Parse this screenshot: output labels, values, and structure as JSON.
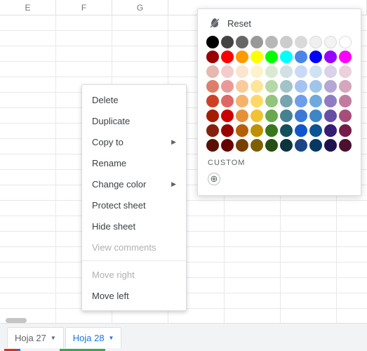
{
  "columns": [
    "E",
    "F",
    "G"
  ],
  "context_menu": {
    "items": [
      {
        "label": "Delete",
        "has_sub": false,
        "disabled": false,
        "key": "delete"
      },
      {
        "label": "Duplicate",
        "has_sub": false,
        "disabled": false,
        "key": "duplicate"
      },
      {
        "label": "Copy to",
        "has_sub": true,
        "disabled": false,
        "key": "copy-to"
      },
      {
        "label": "Rename",
        "has_sub": false,
        "disabled": false,
        "key": "rename"
      },
      {
        "label": "Change color",
        "has_sub": true,
        "disabled": false,
        "key": "change-color",
        "highlighted": true
      },
      {
        "label": "Protect sheet",
        "has_sub": false,
        "disabled": false,
        "key": "protect-sheet"
      },
      {
        "label": "Hide sheet",
        "has_sub": false,
        "disabled": false,
        "key": "hide-sheet"
      },
      {
        "label": "View comments",
        "has_sub": false,
        "disabled": true,
        "key": "view-comments"
      },
      {
        "sep": true
      },
      {
        "label": "Move right",
        "has_sub": false,
        "disabled": true,
        "key": "move-right"
      },
      {
        "label": "Move left",
        "has_sub": false,
        "disabled": false,
        "key": "move-left"
      }
    ]
  },
  "color_panel": {
    "reset_label": "Reset",
    "custom_label": "CUSTOM",
    "rows": [
      [
        "#000000",
        "#434343",
        "#666666",
        "#999999",
        "#b7b7b7",
        "#cccccc",
        "#d9d9d9",
        "#efefef",
        "#f3f3f3",
        "#ffffff"
      ],
      [
        "#980000",
        "#ff0000",
        "#ff9900",
        "#ffff00",
        "#00ff00",
        "#00ffff",
        "#4a86e8",
        "#0000ff",
        "#9900ff",
        "#ff00ff"
      ],
      [
        "#e6b8af",
        "#f4cccc",
        "#fce5cd",
        "#fff2cc",
        "#d9ead3",
        "#d0e0e3",
        "#c9daf8",
        "#cfe2f3",
        "#d9d2e9",
        "#ead1dc"
      ],
      [
        "#dd7e6b",
        "#ea9999",
        "#f9cb9c",
        "#ffe599",
        "#b6d7a8",
        "#a2c4c9",
        "#a4c2f4",
        "#9fc5e8",
        "#b4a7d6",
        "#d5a6bd"
      ],
      [
        "#cc4125",
        "#e06666",
        "#f6b26b",
        "#ffd966",
        "#93c47d",
        "#76a5af",
        "#6d9eeb",
        "#6fa8dc",
        "#8e7cc3",
        "#c27ba0"
      ],
      [
        "#a61c00",
        "#cc0000",
        "#e69138",
        "#f1c232",
        "#6aa84f",
        "#45818e",
        "#3c78d8",
        "#3d85c6",
        "#674ea7",
        "#a64d79"
      ],
      [
        "#85200c",
        "#990000",
        "#b45f06",
        "#bf9000",
        "#38761d",
        "#134f5c",
        "#1155cc",
        "#0b5394",
        "#351c75",
        "#741b47"
      ],
      [
        "#5b0f00",
        "#660000",
        "#783f04",
        "#7f6000",
        "#274e13",
        "#0c343d",
        "#1c4587",
        "#073763",
        "#20124d",
        "#4c1130"
      ]
    ]
  },
  "sheet_tabs": [
    {
      "label": "Hoja 27",
      "active": false,
      "key": "hoja-27"
    },
    {
      "label": "Hoja 28",
      "active": true,
      "key": "hoja-28"
    }
  ]
}
